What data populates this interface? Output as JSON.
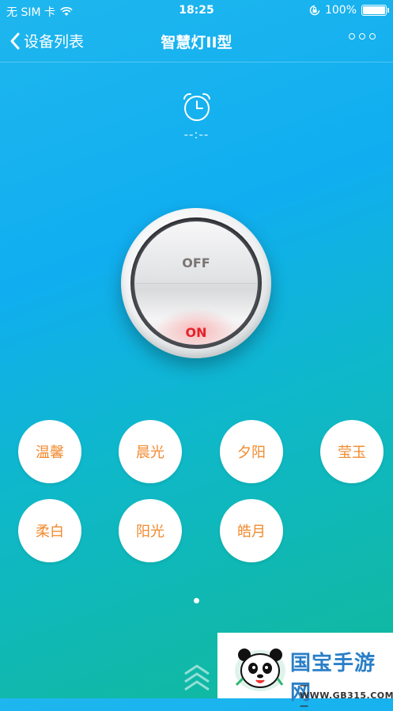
{
  "status_bar": {
    "carrier": "无 SIM 卡",
    "time": "18:25",
    "battery_text": "100%",
    "battery_level": 1.0,
    "icons": [
      "wifi-icon",
      "orientation-lock-icon",
      "battery-icon"
    ]
  },
  "nav": {
    "back_label": "设备列表",
    "title": "智慧灯II型",
    "more_icon": "more-icon"
  },
  "timer": {
    "icon": "alarm-clock-icon",
    "value": "--:--"
  },
  "power_switch": {
    "off_label": "OFF",
    "on_label": "ON",
    "state": "on"
  },
  "modes": [
    {
      "label": "温馨"
    },
    {
      "label": "晨光"
    },
    {
      "label": "夕阳"
    },
    {
      "label": "莹玉"
    },
    {
      "label": "柔白"
    },
    {
      "label": "阳光"
    },
    {
      "label": "皓月"
    }
  ],
  "pager": {
    "pages": 1,
    "current": 1
  },
  "watermark": {
    "title": "国宝手游网",
    "url": "— WWW.GB315.COM —"
  },
  "colors": {
    "accent_orange": "#f28a2e",
    "switch_on_red": "#e5222a",
    "bg_top": "#1fb6ee",
    "bg_bottom": "#10b99a"
  }
}
